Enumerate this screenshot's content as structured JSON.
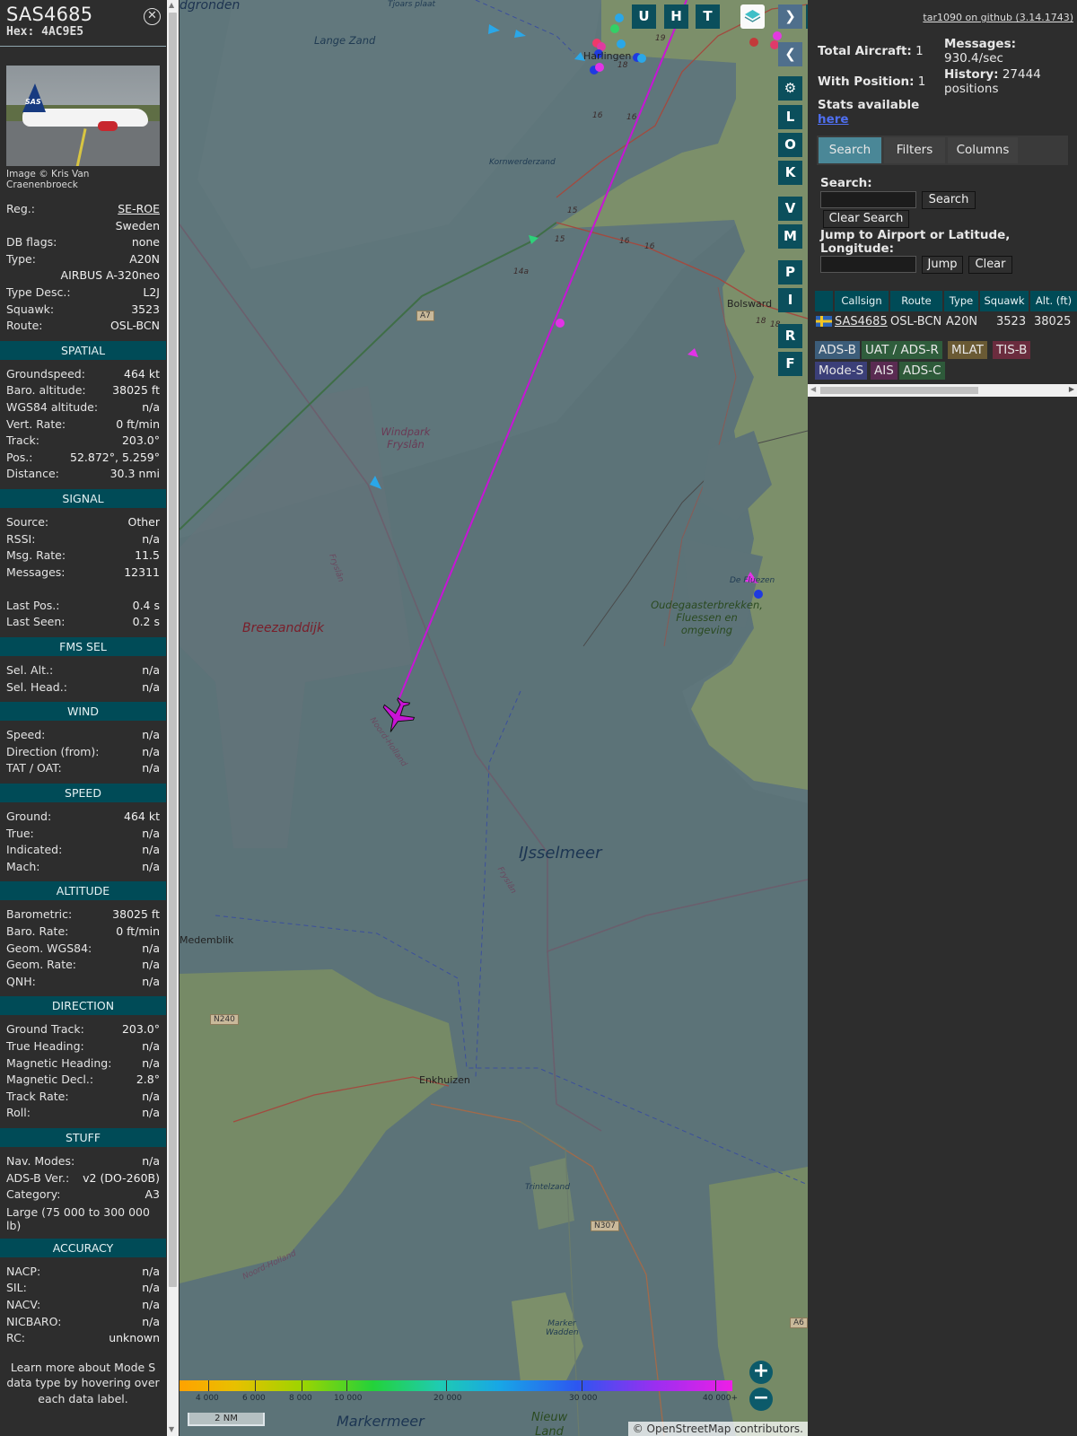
{
  "aircraft": {
    "callsign": "SAS4685",
    "hex_label": "Hex:",
    "hex": "4AC9E5",
    "close_icon": "close-icon",
    "photo_credit": "Image © Kris Van Craenenbroeck",
    "photo_logo_text": "SAS"
  },
  "details": [
    {
      "label": "Reg.:",
      "value": "SE-ROE",
      "link": true
    },
    {
      "label": "",
      "value": "Sweden"
    },
    {
      "label": "DB flags:",
      "value": "none"
    },
    {
      "label": "Type:",
      "value": "A20N"
    },
    {
      "label": "",
      "value": "AIRBUS A-320neo"
    },
    {
      "label": "Type Desc.:",
      "value": "L2J"
    },
    {
      "label": "Squawk:",
      "value": "3523"
    },
    {
      "label": "Route:",
      "value": "OSL-BCN"
    }
  ],
  "sections": [
    {
      "title": "SPATIAL",
      "rows": [
        {
          "label": "Groundspeed:",
          "value": "464 kt"
        },
        {
          "label": "Baro. altitude:",
          "value": "38025 ft"
        },
        {
          "label": "WGS84 altitude:",
          "value": "n/a"
        },
        {
          "label": "Vert. Rate:",
          "value": "0 ft/min"
        },
        {
          "label": "Track:",
          "value": "203.0°"
        },
        {
          "label": "Pos.:",
          "value": "52.872°, 5.259°"
        },
        {
          "label": "Distance:",
          "value": "30.3 nmi"
        }
      ]
    },
    {
      "title": "SIGNAL",
      "rows": [
        {
          "label": "Source:",
          "value": "Other"
        },
        {
          "label": "RSSI:",
          "value": "n/a"
        },
        {
          "label": "Msg. Rate:",
          "value": "11.5"
        },
        {
          "label": "Messages:",
          "value": "12311"
        },
        {
          "label": "",
          "value": ""
        },
        {
          "label": "Last Pos.:",
          "value": "0.4 s"
        },
        {
          "label": "Last Seen:",
          "value": "0.2 s"
        }
      ]
    },
    {
      "title": "FMS SEL",
      "rows": [
        {
          "label": "Sel. Alt.:",
          "value": "n/a"
        },
        {
          "label": "Sel. Head.:",
          "value": "n/a"
        }
      ]
    },
    {
      "title": "WIND",
      "rows": [
        {
          "label": "Speed:",
          "value": "n/a"
        },
        {
          "label": "Direction (from):",
          "value": "n/a"
        },
        {
          "label": "TAT / OAT:",
          "value": "n/a"
        }
      ]
    },
    {
      "title": "SPEED",
      "rows": [
        {
          "label": "Ground:",
          "value": "464 kt"
        },
        {
          "label": "True:",
          "value": "n/a"
        },
        {
          "label": "Indicated:",
          "value": "n/a"
        },
        {
          "label": "Mach:",
          "value": "n/a"
        }
      ]
    },
    {
      "title": "ALTITUDE",
      "rows": [
        {
          "label": "Barometric:",
          "value": "38025 ft"
        },
        {
          "label": "Baro. Rate:",
          "value": "0 ft/min"
        },
        {
          "label": "Geom. WGS84:",
          "value": "n/a"
        },
        {
          "label": "Geom. Rate:",
          "value": "n/a"
        },
        {
          "label": "QNH:",
          "value": "n/a"
        }
      ]
    },
    {
      "title": "DIRECTION",
      "rows": [
        {
          "label": "Ground Track:",
          "value": "203.0°"
        },
        {
          "label": "True Heading:",
          "value": "n/a"
        },
        {
          "label": "Magnetic Heading:",
          "value": "n/a"
        },
        {
          "label": "Magnetic Decl.:",
          "value": "2.8°"
        },
        {
          "label": "Track Rate:",
          "value": "n/a"
        },
        {
          "label": "Roll:",
          "value": "n/a"
        }
      ]
    },
    {
      "title": "STUFF",
      "rows": [
        {
          "label": "Nav. Modes:",
          "value": "n/a"
        },
        {
          "label": "ADS-B Ver.:",
          "value": "v2 (DO-260B)"
        },
        {
          "label": "Category:",
          "value": "A3"
        },
        {
          "label": "Large (75 000 to 300 000 lb)",
          "value": ""
        }
      ]
    },
    {
      "title": "ACCURACY",
      "rows": [
        {
          "label": "NACP:",
          "value": "n/a"
        },
        {
          "label": "SIL:",
          "value": "n/a"
        },
        {
          "label": "NACV:",
          "value": "n/a"
        },
        {
          "label": "NICBARO:",
          "value": "n/a"
        },
        {
          "label": "RC:",
          "value": "unknown"
        }
      ]
    }
  ],
  "footnote": "Learn more about Mode S data type by hovering over each data label.",
  "map": {
    "labels": [
      {
        "text": "dgronden",
        "cls": "big"
      },
      {
        "text": "Tjoars plaat",
        "cls": "small"
      },
      {
        "text": "Lange Zand",
        "cls": "mid"
      },
      {
        "text": "Harlingen",
        "cls": "town"
      },
      {
        "text": "Kornwerderzand",
        "cls": "small"
      },
      {
        "text": "Windpark Fryslân",
        "cls": "mid"
      },
      {
        "text": "Breezanddijk",
        "cls": "red"
      },
      {
        "text": "IJsselmeer",
        "cls": "lake"
      },
      {
        "text": "Bolsward",
        "cls": "town"
      },
      {
        "text": "De Fluezen",
        "cls": "small"
      },
      {
        "text": "Oudegaasterbrekken, Fluessen en omgeving",
        "cls": "green"
      },
      {
        "text": "Medemblik",
        "cls": "town"
      },
      {
        "text": "Enkhuizen",
        "cls": "town"
      },
      {
        "text": "Trintelzand",
        "cls": "small"
      },
      {
        "text": "Marker Wadden",
        "cls": "small"
      },
      {
        "text": "Markermeer",
        "cls": "lake"
      },
      {
        "text": "Nieuw Land",
        "cls": "green"
      },
      {
        "text": "Fryslân",
        "cls": "border"
      },
      {
        "text": "Noord-Holland",
        "cls": "border"
      },
      {
        "text": "Fryslân",
        "cls": "border"
      },
      {
        "text": "Noord-Holland",
        "cls": "border"
      }
    ],
    "road_labels": [
      "A7",
      "N240",
      "N307",
      "A6",
      "14a",
      "15",
      "15",
      "16",
      "16",
      "16",
      "18",
      "18",
      "18",
      "19",
      "16"
    ],
    "buttons": [
      "U",
      "H",
      "T",
      "L",
      "O",
      "K",
      "V",
      "M",
      "P",
      "I",
      "R",
      "F"
    ],
    "layers_icon": "layers-icon",
    "settings_icon": "gear-icon",
    "next_icon": "chevron-right-icon",
    "prev_icon": "chevron-left-icon",
    "expand_icon": "expand-arrows-icon",
    "zoom_in": "+",
    "zoom_out": "−",
    "altitude_ticks": [
      "4 000",
      "6 000",
      "8 000",
      "10 000",
      "20 000",
      "30 000",
      "40 000+"
    ],
    "scale": "2 NM",
    "attribution": "© OpenStreetMap contributors."
  },
  "sidebar": {
    "version_link": "tar1090 on github (3.14.1743)",
    "total_aircraft_label": "Total Aircraft:",
    "total_aircraft": "1",
    "with_position_label": "With Position:",
    "with_position": "1",
    "messages_label": "Messages:",
    "messages": "930.4/sec",
    "history_label": "History:",
    "history": "27444 positions",
    "stats_label": "Stats available",
    "stats_link": "here",
    "tabs": [
      "Search",
      "Filters",
      "Columns"
    ],
    "search_label": "Search:",
    "search_placeholder": "",
    "search_button": "Search",
    "clear_search_button": "Clear Search",
    "jump_label": "Jump to Airport or Latitude, Longitude:",
    "jump_placeholder": "",
    "jump_button": "Jump",
    "clear_button": "Clear",
    "table_headers": [
      "",
      "Callsign",
      "Route",
      "Type",
      "Squawk",
      "Alt. (ft)"
    ],
    "table_row": {
      "flag": "sweden-flag-icon",
      "callsign": "SAS4685",
      "route": "OSL-BCN",
      "type": "A20N",
      "squawk": "3523",
      "alt": "38025"
    },
    "chips": [
      {
        "text": "ADS-B",
        "color": "#3c5d7a"
      },
      {
        "text": "UAT / ADS-R",
        "color": "#2f5d3c"
      },
      {
        "text": "MLAT",
        "color": "#6a5a34"
      },
      {
        "text": "TIS-B",
        "color": "#6b2c3e"
      },
      {
        "text": "Mode-S",
        "color": "#3b3f78"
      },
      {
        "text": "AIS",
        "color": "#5a2b52"
      },
      {
        "text": "ADS-C",
        "color": "#2e5a3a"
      }
    ]
  }
}
